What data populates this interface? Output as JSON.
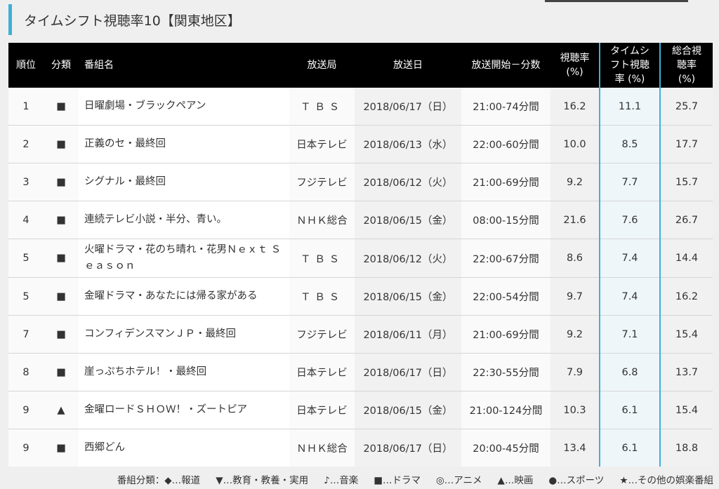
{
  "page_title": "タイムシフト視聴率10【関東地区】",
  "table": {
    "headers": {
      "rank": "順位",
      "genre": "分類",
      "name": "番組名",
      "station": "放送局",
      "date": "放送日",
      "time": "放送開始－分数",
      "rating_line1": "視聴率",
      "rating_line2": "(%)",
      "ts_line1": "タイムシ",
      "ts_line2": "フト視聴",
      "ts_line3": "率 (%)",
      "total_line1": "総合視",
      "total_line2": "聴率",
      "total_line3": "(%)"
    },
    "rows": [
      {
        "rank": "1",
        "genre": "■",
        "name": "日曜劇場・ブラックペアン",
        "station": "ＴＢＳ",
        "date": "2018/06/17（日）",
        "time": "21:00-74分間",
        "rating": "16.2",
        "timeshift": "11.1",
        "total": "25.7"
      },
      {
        "rank": "2",
        "genre": "■",
        "name": "正義のセ・最終回",
        "station": "日本テレビ",
        "date": "2018/06/13（水）",
        "time": "22:00-60分間",
        "rating": "10.0",
        "timeshift": "8.5",
        "total": "17.7"
      },
      {
        "rank": "3",
        "genre": "■",
        "name": "シグナル・最終回",
        "station": "フジテレビ",
        "date": "2018/06/12（火）",
        "time": "21:00-69分間",
        "rating": "9.2",
        "timeshift": "7.7",
        "total": "15.7"
      },
      {
        "rank": "4",
        "genre": "■",
        "name": "連続テレビ小説・半分、青い。",
        "station": "ＮＨＫ総合",
        "date": "2018/06/15（金）",
        "time": "08:00-15分間",
        "rating": "21.6",
        "timeshift": "7.6",
        "total": "26.7"
      },
      {
        "rank": "5",
        "genre": "■",
        "name": "火曜ドラマ・花のち晴れ・花男Ｎｅｘｔ Ｓｅａｓｏｎ",
        "station": "ＴＢＳ",
        "date": "2018/06/12（火）",
        "time": "22:00-67分間",
        "rating": "8.6",
        "timeshift": "7.4",
        "total": "14.4"
      },
      {
        "rank": "5",
        "genre": "■",
        "name": "金曜ドラマ・あなたには帰る家がある",
        "station": "ＴＢＳ",
        "date": "2018/06/15（金）",
        "time": "22:00-54分間",
        "rating": "9.7",
        "timeshift": "7.4",
        "total": "16.2"
      },
      {
        "rank": "7",
        "genre": "■",
        "name": "コンフィデンスマンＪＰ・最終回",
        "station": "フジテレビ",
        "date": "2018/06/11（月）",
        "time": "21:00-69分間",
        "rating": "9.2",
        "timeshift": "7.1",
        "total": "15.4"
      },
      {
        "rank": "8",
        "genre": "■",
        "name": "崖っぷちホテル！・最終回",
        "station": "日本テレビ",
        "date": "2018/06/17（日）",
        "time": "22:30-55分間",
        "rating": "7.9",
        "timeshift": "6.8",
        "total": "13.7"
      },
      {
        "rank": "9",
        "genre": "▲",
        "name": "金曜ロードＳＨＯＷ！・ズートピア",
        "station": "日本テレビ",
        "date": "2018/06/15（金）",
        "time": "21:00-124分間",
        "rating": "10.3",
        "timeshift": "6.1",
        "total": "15.4"
      },
      {
        "rank": "9",
        "genre": "■",
        "name": "西郷どん",
        "station": "ＮＨＫ総合",
        "date": "2018/06/17（日）",
        "time": "20:00-45分間",
        "rating": "13.4",
        "timeshift": "6.1",
        "total": "18.8"
      }
    ]
  },
  "legend": {
    "label": "番組分類：",
    "items": [
      "◆…報道",
      "▼…教育・教養・実用",
      "♪…音楽",
      "■…ドラマ",
      "◎…アニメ",
      "▲…映画",
      "●…スポーツ",
      "★…その他の娯楽番組"
    ]
  },
  "colors": {
    "accent": "#3fb0d8",
    "header_bg": "#000000",
    "page_bg": "#efefef"
  }
}
